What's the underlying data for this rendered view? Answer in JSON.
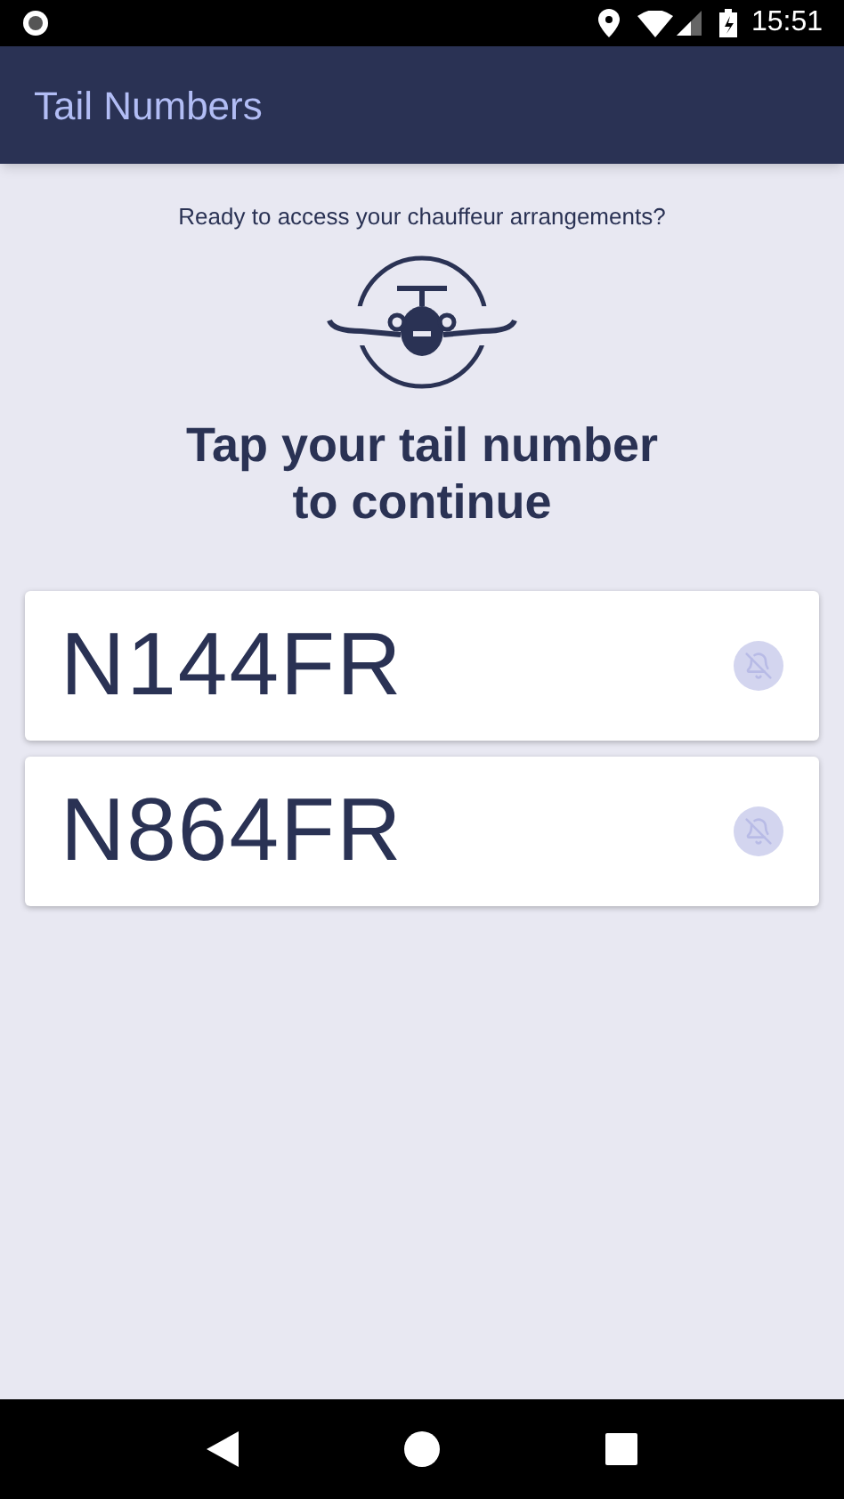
{
  "status_bar": {
    "time": "15:51"
  },
  "app_bar": {
    "title": "Tail Numbers"
  },
  "prompt": "Ready to access your chauffeur arrangements?",
  "heading": "Tap your tail number to continue",
  "tail_numbers": [
    {
      "label": "N144FR"
    },
    {
      "label": "N864FR"
    }
  ]
}
